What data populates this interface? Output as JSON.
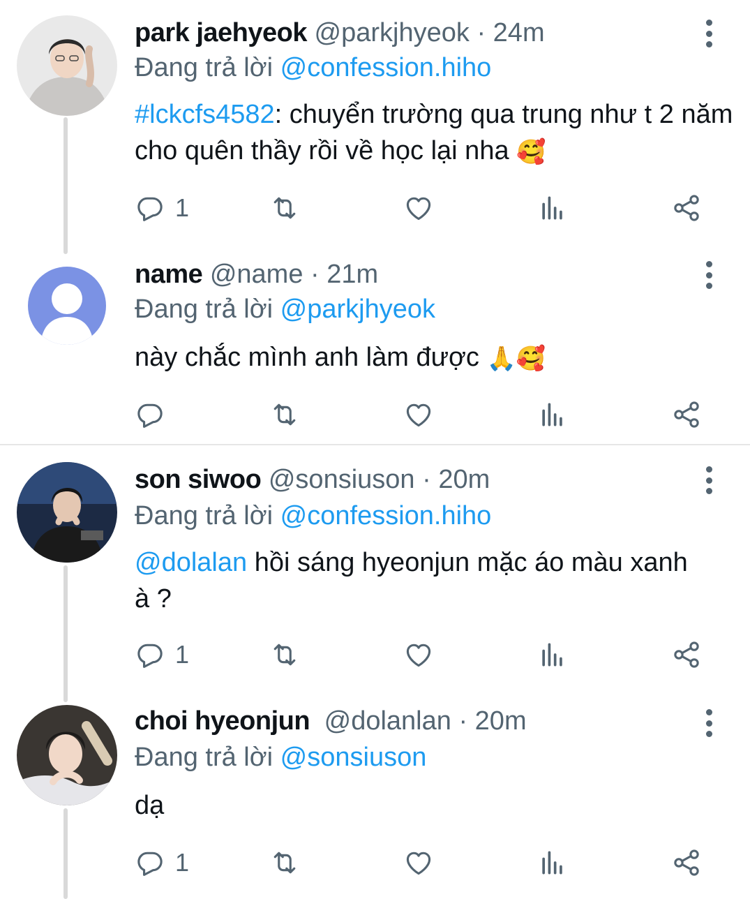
{
  "colors": {
    "link": "#1d9bf0",
    "meta": "#536471",
    "text": "#0f1419",
    "thread_line": "#d9d9d9"
  },
  "tweets": [
    {
      "display_name": "park jaehyeok",
      "handle": "@parkjhyeok",
      "separator": "·",
      "time": "24m",
      "replying_prefix": "Đang trả lời",
      "replying_to": "@confession.hiho",
      "text_link": "#lckcfs4582",
      "text": ": chuyển trường qua trung như t 2 năm cho quên thầy rồi về học lại nha",
      "emoji": "🥰",
      "reply_count": "1",
      "avatar_icon": "photo-avatar"
    },
    {
      "display_name": "name",
      "handle": "@name",
      "separator": "·",
      "time": "21m",
      "replying_prefix": "Đang trả lời",
      "replying_to": "@parkjhyeok",
      "text": "này chắc mình anh làm được ",
      "emoji": "🙏🥰",
      "reply_count": "",
      "avatar_icon": "default-user-avatar"
    },
    {
      "display_name": "son siwoo",
      "handle": "@sonsiuson",
      "separator": "·",
      "time": "20m",
      "replying_prefix": "Đang trả lời",
      "replying_to": "@confession.hiho",
      "text_link": "@dolalan",
      "text": " hồi sáng hyeonjun mặc áo màu xanh à ?",
      "reply_count": "1",
      "avatar_icon": "photo-avatar"
    },
    {
      "display_name": "choi hyeonjun",
      "handle": "@dolanlan",
      "separator": "·",
      "time": "20m",
      "replying_prefix": "Đang trả lời",
      "replying_to": "@sonsiuson",
      "text": "dạ",
      "reply_count": "1",
      "avatar_icon": "photo-avatar"
    }
  ]
}
